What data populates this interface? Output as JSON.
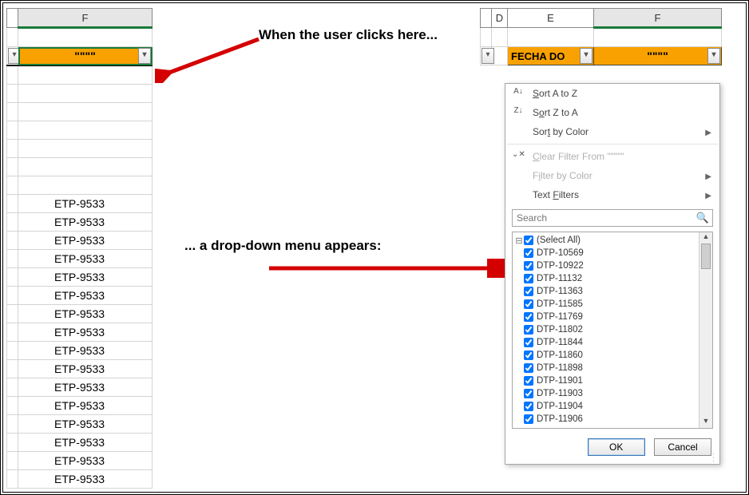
{
  "annotations": {
    "click_here": "When the user clicks here...",
    "appears": "... a drop-down menu appears:"
  },
  "left": {
    "col_header": "F",
    "filter_label": "\"\"\"\"",
    "data_value": "ETP-9533",
    "row_count": 16
  },
  "right": {
    "headers": {
      "d": "D",
      "e": "E",
      "f": "F"
    },
    "e_filter_label": "FECHA DO",
    "f_filter_label": "\"\"\"\""
  },
  "menu": {
    "sort_az": "Sort A to Z",
    "sort_za": "Sort Z to A",
    "sort_color": "Sort by Color",
    "clear": "Clear Filter From",
    "clear_suffix": "\"\"\"\"\"",
    "filter_color": "Filter by Color",
    "text_filters": "Text Filters",
    "search_placeholder": "Search",
    "select_all": "(Select All)",
    "items": [
      "DTP-10569",
      "DTP-10922",
      "DTP-11132",
      "DTP-11363",
      "DTP-11585",
      "DTP-11769",
      "DTP-11802",
      "DTP-11844",
      "DTP-11860",
      "DTP-11898",
      "DTP-11901",
      "DTP-11903",
      "DTP-11904",
      "DTP-11906"
    ],
    "ok": "OK",
    "cancel": "Cancel"
  }
}
